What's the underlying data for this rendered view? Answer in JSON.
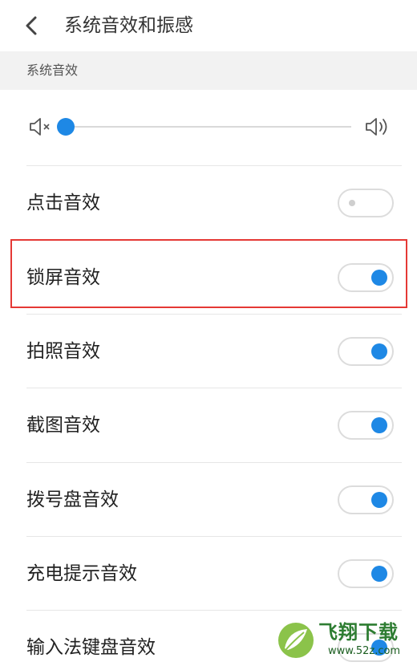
{
  "header": {
    "title": "系统音效和振感"
  },
  "section": {
    "label": "系统音效"
  },
  "volume": {
    "level": 0,
    "min_icon": "volume-mute-icon",
    "max_icon": "volume-max-icon"
  },
  "rows": [
    {
      "label": "点击音效",
      "on": false
    },
    {
      "label": "锁屏音效",
      "on": true
    },
    {
      "label": "拍照音效",
      "on": true
    },
    {
      "label": "截图音效",
      "on": true
    },
    {
      "label": "拨号盘音效",
      "on": true
    },
    {
      "label": "充电提示音效",
      "on": true
    },
    {
      "label": "输入法键盘音效",
      "on": true
    }
  ],
  "watermark": {
    "brand": "飞翔下载",
    "url": "www.52z.com"
  },
  "colors": {
    "accent": "#1e88e5",
    "highlight": "#e53935"
  }
}
